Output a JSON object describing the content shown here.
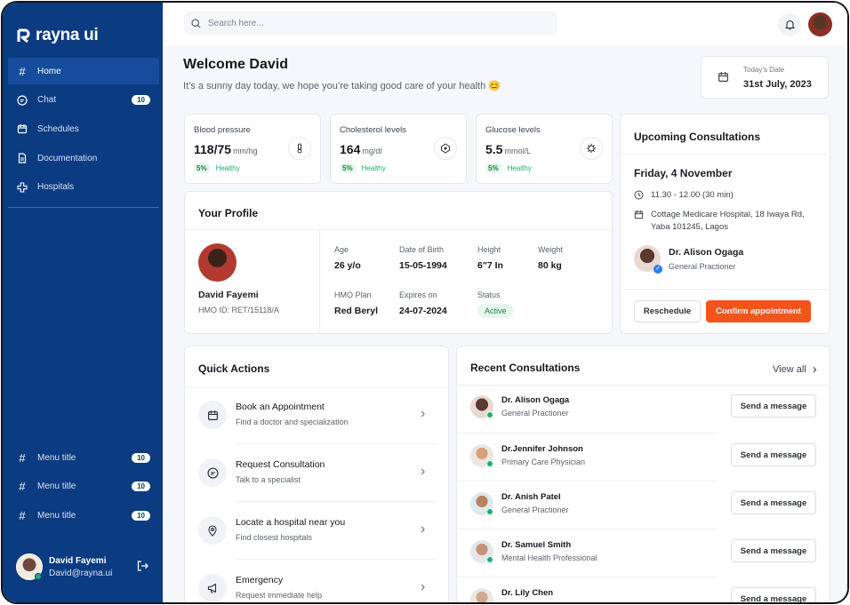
{
  "brand": {
    "name": "rayna ui"
  },
  "sidebar": {
    "items": [
      {
        "label": "Home",
        "icon": "hash-icon",
        "active": true
      },
      {
        "label": "Chat",
        "icon": "chat-icon",
        "badge": "10"
      },
      {
        "label": "Schedules",
        "icon": "calendar-icon"
      },
      {
        "label": "Documentation",
        "icon": "document-icon"
      },
      {
        "label": "Hospitals",
        "icon": "hospital-cross-icon"
      }
    ],
    "menu_titles": [
      {
        "label": "Menu title",
        "badge": "10"
      },
      {
        "label": "Menu title",
        "badge": "10"
      },
      {
        "label": "Menu title",
        "badge": "10"
      }
    ],
    "user": {
      "name": "David Fayemi",
      "email": "David@rayna.ui"
    }
  },
  "topbar": {
    "search_placeholder": "Search here..."
  },
  "welcome": {
    "title": "Welcome David",
    "subtitle": "It’s a sunny day today, we hope you’re taking good care of your health 😊",
    "date_label": "Today's Date",
    "date_value": "31st July, 2023"
  },
  "stats": [
    {
      "title": "Blood pressure",
      "value": "118/75",
      "unit": "mm/hg",
      "pct": "5%",
      "status": "Healthy",
      "icon": "thermometer-icon"
    },
    {
      "title": "Cholesterol levels",
      "value": "164",
      "unit": "mg/dl",
      "pct": "5%",
      "status": "Healthy",
      "icon": "molecule-icon"
    },
    {
      "title": "Glucose levels",
      "value": "5.5",
      "unit": "mmol/L",
      "pct": "5%",
      "status": "Healthy",
      "icon": "virus-icon"
    }
  ],
  "profile": {
    "title": "Your Profile",
    "name": "David Fayemi",
    "hmo_id": "HMO ID: RET/15118/A",
    "fields": {
      "age": {
        "label": "Age",
        "value": "26 y/o"
      },
      "dob": {
        "label": "Date of Birth",
        "value": "15-05-1994"
      },
      "height": {
        "label": "Height",
        "value": "6\"7 In"
      },
      "weight": {
        "label": "Weight",
        "value": "80 kg"
      },
      "plan": {
        "label": "HMO Plan",
        "value": "Red Beryl"
      },
      "expires": {
        "label": "Expires on",
        "value": "24-07-2024"
      },
      "status": {
        "label": "Status",
        "value": "Active"
      }
    }
  },
  "upcoming": {
    "title": "Upcoming Consultations",
    "date": "Friday, 4 November",
    "time": "11.30 - 12.00 (30 min)",
    "location": "Cottage Medicare Hospital, 18 Iwaya Rd, Yaba 101245, Lagos",
    "doctor": {
      "name": "Dr. Alison Ogaga",
      "role": "General Practioner"
    },
    "reschedule_label": "Reschedule",
    "confirm_label": "Confirm appointment"
  },
  "quick_actions": {
    "title": "Quick Actions",
    "items": [
      {
        "title": "Book an Appointment",
        "subtitle": "Find a doctor and specialization",
        "icon": "calendar-icon"
      },
      {
        "title": "Request Consultation",
        "subtitle": "Talk to a specialist",
        "icon": "chat-icon"
      },
      {
        "title": "Locate a hospital near you",
        "subtitle": "Find closest hospitals",
        "icon": "location-pin-icon"
      },
      {
        "title": "Emergency",
        "subtitle": "Request immediate help",
        "icon": "megaphone-icon"
      }
    ]
  },
  "recent": {
    "title": "Recent Consultations",
    "view_all": "View all",
    "button_label": "Send a message",
    "items": [
      {
        "name": "Dr. Alison Ogaga",
        "role": "General Practioner"
      },
      {
        "name": "Dr.Jennifer Johnson",
        "role": "Primary Care Physician"
      },
      {
        "name": "Dr. Anish Patel",
        "role": "General Practioner"
      },
      {
        "name": "Dr. Samuel Smith",
        "role": "Mental Health Professional"
      },
      {
        "name": "Dr. Lily Chen",
        "role": ""
      }
    ]
  },
  "colors": {
    "sidebar": "#0b3b80",
    "active_nav": "#154c9c",
    "primary": "#f2551b",
    "healthy": "#17b26a"
  }
}
